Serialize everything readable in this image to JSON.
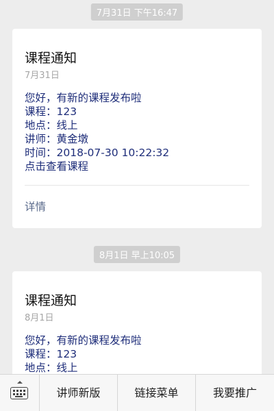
{
  "messages": [
    {
      "timestamp": "7月31日 下午16:47",
      "title": "课程通知",
      "date": "7月31日",
      "greeting": "您好，有新的课程发布啦",
      "course_label": "课程：",
      "course_value": "123",
      "location_label": "地点：",
      "location_value": "线上",
      "lecturer_label": "讲师：",
      "lecturer_value": "黄金墩",
      "time_label": "时间：",
      "time_value": "2018-07-30 10:22:32",
      "cta": "点击查看课程",
      "detail": "详情"
    },
    {
      "timestamp": "8月1日 早上10:05",
      "title": "课程通知",
      "date": "8月1日",
      "greeting": "您好，有新的课程发布啦",
      "course_label": "课程：",
      "course_value": "123",
      "location_label": "地点：",
      "location_value": "线上"
    }
  ],
  "menu": {
    "keyboard_icon": "keyboard-icon",
    "items": [
      "讲师新版",
      "链接菜单",
      "我要推广"
    ]
  },
  "colors": {
    "link_text": "#1f2e7a",
    "detail_text": "#5b6b8c",
    "timestamp_bg": "#cfcfcf",
    "page_bg": "#ededed"
  }
}
